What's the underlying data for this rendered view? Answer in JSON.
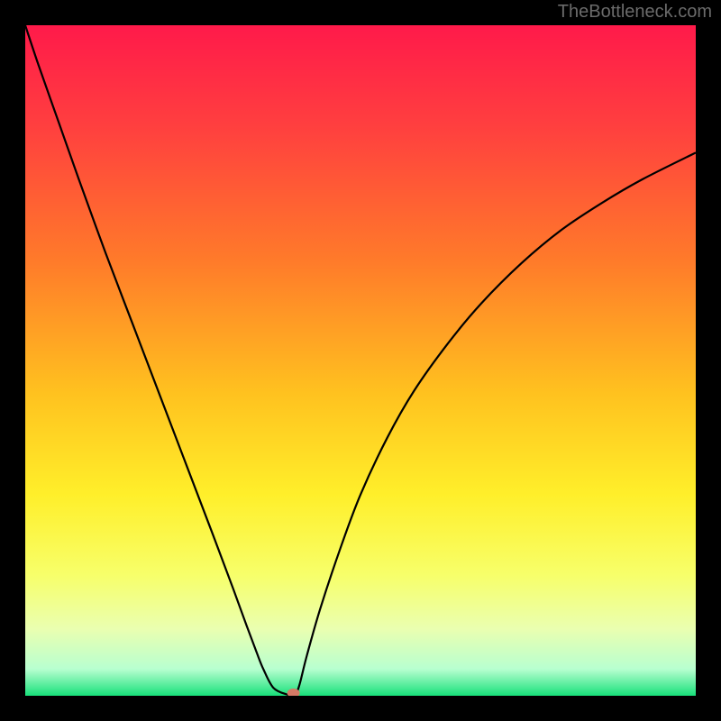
{
  "watermark": "TheBottleneck.com",
  "chart_data": {
    "type": "line",
    "title": "",
    "xlabel": "",
    "ylabel": "",
    "xlim": [
      0,
      100
    ],
    "ylim": [
      0,
      100
    ],
    "background_gradient": {
      "stops": [
        {
          "pos": 0.0,
          "color": "#ff1a4a"
        },
        {
          "pos": 0.15,
          "color": "#ff3f3f"
        },
        {
          "pos": 0.35,
          "color": "#ff7a2a"
        },
        {
          "pos": 0.55,
          "color": "#ffc21f"
        },
        {
          "pos": 0.7,
          "color": "#ffef2a"
        },
        {
          "pos": 0.82,
          "color": "#f7ff6a"
        },
        {
          "pos": 0.9,
          "color": "#eaffb0"
        },
        {
          "pos": 0.96,
          "color": "#b8ffd0"
        },
        {
          "pos": 1.0,
          "color": "#18e07a"
        }
      ]
    },
    "curve": {
      "x": [
        0,
        2,
        5,
        8,
        12,
        16,
        20,
        24,
        28,
        31,
        33,
        34.5,
        35.5,
        37,
        39,
        40,
        40.5,
        41,
        42,
        44,
        47,
        50,
        54,
        58,
        63,
        68,
        74,
        80,
        86,
        92,
        100
      ],
      "y": [
        100,
        94,
        85.5,
        77,
        66,
        55.5,
        45,
        34.5,
        24,
        16,
        10.5,
        6.5,
        4,
        1.2,
        0.2,
        0.1,
        0.5,
        2,
        6,
        13,
        22,
        30,
        38.5,
        45.5,
        52.5,
        58.5,
        64.5,
        69.5,
        73.5,
        77,
        81
      ]
    },
    "marker": {
      "x": 40,
      "y": 0.4,
      "color": "#d47a66"
    }
  }
}
